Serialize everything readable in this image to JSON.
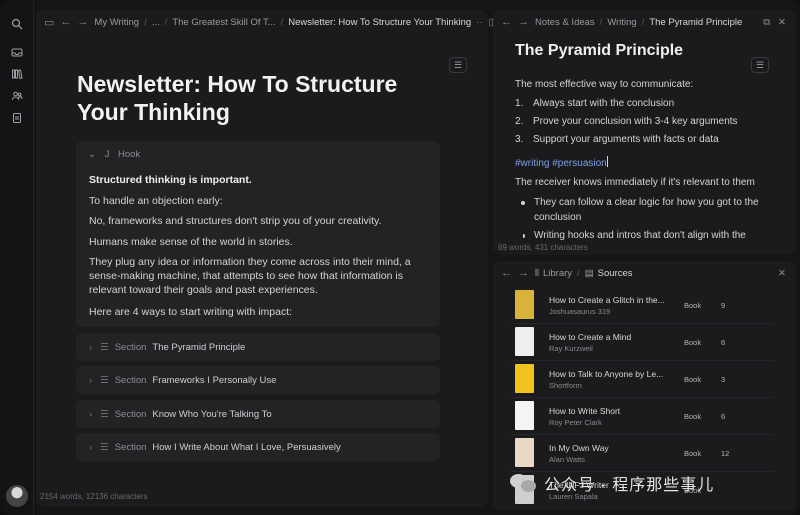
{
  "left_pane": {
    "breadcrumb": [
      "My Writing",
      "...",
      "The Greatest Skill Of T...",
      "Newsletter: How To Structure Your Thinking"
    ],
    "title": "Newsletter: How To Structure Your Thinking",
    "hook": {
      "label": "Hook",
      "paragraphs": [
        "Structured thinking is important.",
        "To handle an objection early:",
        "No, frameworks and structures don't strip you of your creativity.",
        "Humans make sense of the world in stories.",
        "They plug any idea or information they come across into their mind, a sense-making machine, that attempts to see how that information is relevant toward their goals and past experiences.",
        "Here are 4 ways to start writing with impact:"
      ]
    },
    "sections": [
      {
        "kind": "Section",
        "name": "The Pyramid Principle"
      },
      {
        "kind": "Section",
        "name": "Frameworks I Personally Use"
      },
      {
        "kind": "Section",
        "name": "Know Who You're Talking To"
      },
      {
        "kind": "Section",
        "name": "How I Write About What I Love, Persuasively"
      }
    ],
    "status": "2154 words, 12136 characters"
  },
  "right_top": {
    "breadcrumb": [
      "Notes & Ideas",
      "Writing",
      "The Pyramid Principle"
    ],
    "title": "The Pyramid Principle",
    "intro": "The most effective way to communicate:",
    "steps": [
      {
        "n": "1.",
        "text": "Always start with the conclusion"
      },
      {
        "n": "2.",
        "text": "Prove your conclusion with 3-4 key arguments"
      },
      {
        "n": "3.",
        "text": "Support your arguments with facts or data"
      }
    ],
    "tags": "#writing #persuasion",
    "receiver": "The receiver knows immediately if it's relevant to them",
    "bullets": [
      "They can follow a clear logic for how you got to the conclusion",
      "Writing hooks and intros that don't align with the"
    ],
    "status": "69 words, 431 characters"
  },
  "right_bottom": {
    "breadcrumb": [
      "Library",
      "Sources"
    ],
    "rows": [
      {
        "title": "How to Create a Glitch in the...",
        "author": "Joshuasaurus 319",
        "type": "Book",
        "count": "9",
        "cover": "#d9b23a"
      },
      {
        "title": "How to Create a Mind",
        "author": "Ray Kurzweil",
        "type": "Book",
        "count": "6",
        "cover": "#eeeeee"
      },
      {
        "title": "How to Talk to Anyone by Le...",
        "author": "Shortform",
        "type": "Book",
        "count": "3",
        "cover": "#f1c21b"
      },
      {
        "title": "How to Write Short",
        "author": "Roy Peter Clark",
        "type": "Book",
        "count": "6",
        "cover": "#f4f4f4"
      },
      {
        "title": "In My Own Way",
        "author": "Alan Watts",
        "type": "Book",
        "count": "12",
        "cover": "#e9d9c4"
      },
      {
        "title": "The INFJ Writer",
        "author": "Lauren Sapala",
        "type": "Book",
        "count": "",
        "cover": "#cfcfcf"
      }
    ]
  },
  "watermark": "公众号 · 程序那些事儿"
}
